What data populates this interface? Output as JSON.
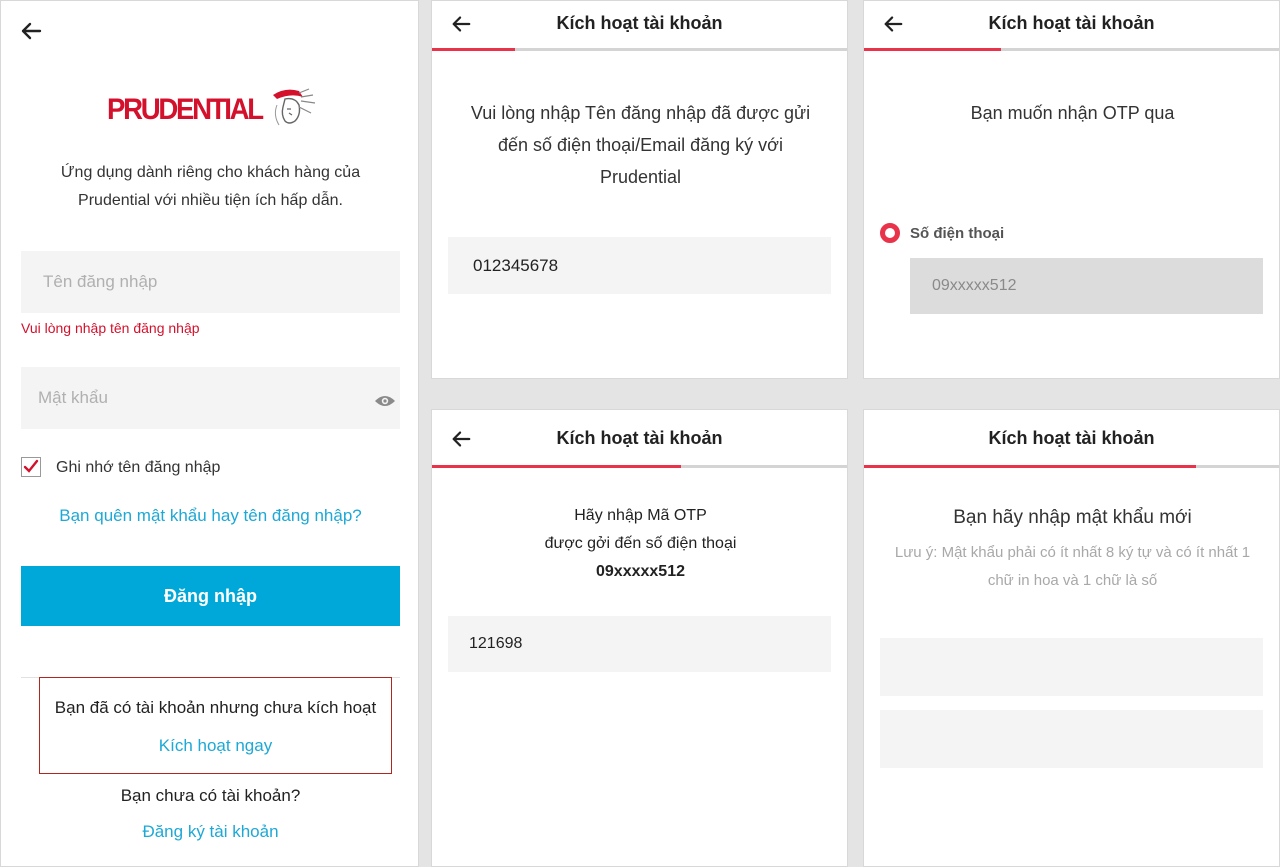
{
  "login": {
    "logo_text": "PRUDENTIAL",
    "intro_line1": "Ứng dụng dành riêng cho khách hàng của",
    "intro_line2": "Prudential với nhiều tiện ích hấp dẫn.",
    "username_placeholder": "Tên đăng nhập",
    "username_error": "Vui lòng nhập tên đăng nhập",
    "password_placeholder": "Mật khẩu",
    "remember_label": "Ghi nhớ tên đăng nhập",
    "remember_checked": true,
    "forgot_link": "Bạn quên mật khẩu hay tên đăng nhập?",
    "login_button": "Đăng nhập",
    "not_activated_text": "Bạn đã có tài khoản nhưng chưa kích hoạt",
    "activate_now_link": "Kích hoạt ngay",
    "no_account_text": "Bạn chưa có tài khoản?",
    "register_link": "Đăng ký tài khoản"
  },
  "step_username": {
    "title": "Kích hoạt tài khoản",
    "progress": 0.2,
    "line1": "Vui lòng nhập Tên đăng nhập đã được gửi",
    "line2": "đến số điện thoại/Email đăng ký với",
    "line3": "Prudential",
    "input_value": "012345678"
  },
  "step_otp_method": {
    "title": "Kích hoạt tài khoản",
    "progress": 0.33,
    "question": "Bạn muốn nhận OTP qua",
    "option_label": "Số điện thoại",
    "phone_masked": "09xxxxx512"
  },
  "step_otp": {
    "title": "Kích hoạt tài khoản",
    "progress": 0.6,
    "line1": "Hãy nhập Mã OTP",
    "line2": "được gởi đến số điện thoại",
    "phone_masked": "09xxxxx512",
    "otp_value": "121698"
  },
  "step_password": {
    "title": "Kích hoạt tài khoản",
    "progress": 0.8,
    "heading": "Bạn hãy nhập mật khẩu mới",
    "note_line1": "Lưu ý: Mật khẩu phải có ít nhất 8 ký tự và có ít nhất 1",
    "note_line2": "chữ in hoa và 1 chữ là số"
  },
  "colors": {
    "brand_red": "#d3112c",
    "accent_blue": "#00a8d9",
    "link_blue": "#1ea8d6",
    "progress_red": "#e8334a"
  }
}
